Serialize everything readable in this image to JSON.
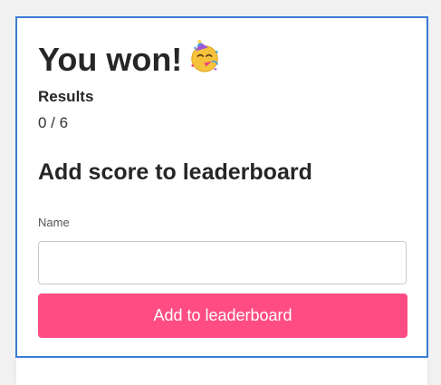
{
  "result": {
    "title": "You won!",
    "emoji_icon": "partying-face-emoji-icon",
    "results_heading": "Results",
    "score": "0 / 6"
  },
  "leaderboard_form": {
    "heading": "Add score to leaderboard",
    "name_label": "Name",
    "name_value": "",
    "name_placeholder": "",
    "submit_label": "Add to leaderboard"
  },
  "colors": {
    "accent": "#ff4d84",
    "focus_border": "#3a7bd5"
  }
}
